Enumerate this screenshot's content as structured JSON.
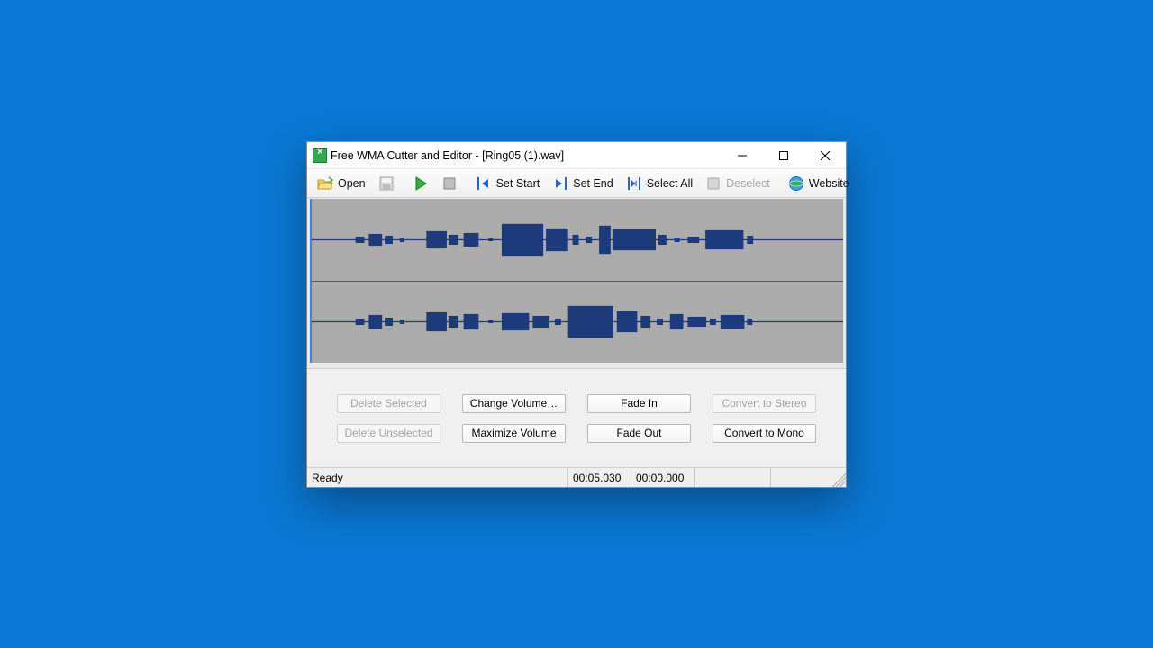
{
  "title": "Free WMA Cutter and Editor - [Ring05 (1).wav]",
  "toolbar": {
    "open": "Open",
    "set_start": "Set Start",
    "set_end": "Set End",
    "select_all": "Select All",
    "deselect": "Deselect",
    "website": "Website"
  },
  "buttons": {
    "delete_selected": "Delete Selected",
    "delete_unselected": "Delete Unselected",
    "change_volume": "Change Volume…",
    "maximize_volume": "Maximize Volume",
    "fade_in": "Fade In",
    "fade_out": "Fade Out",
    "convert_stereo": "Convert to Stereo",
    "convert_mono": "Convert to Mono"
  },
  "status": {
    "ready": "Ready",
    "duration": "00:05.030",
    "position": "00:00.000"
  }
}
